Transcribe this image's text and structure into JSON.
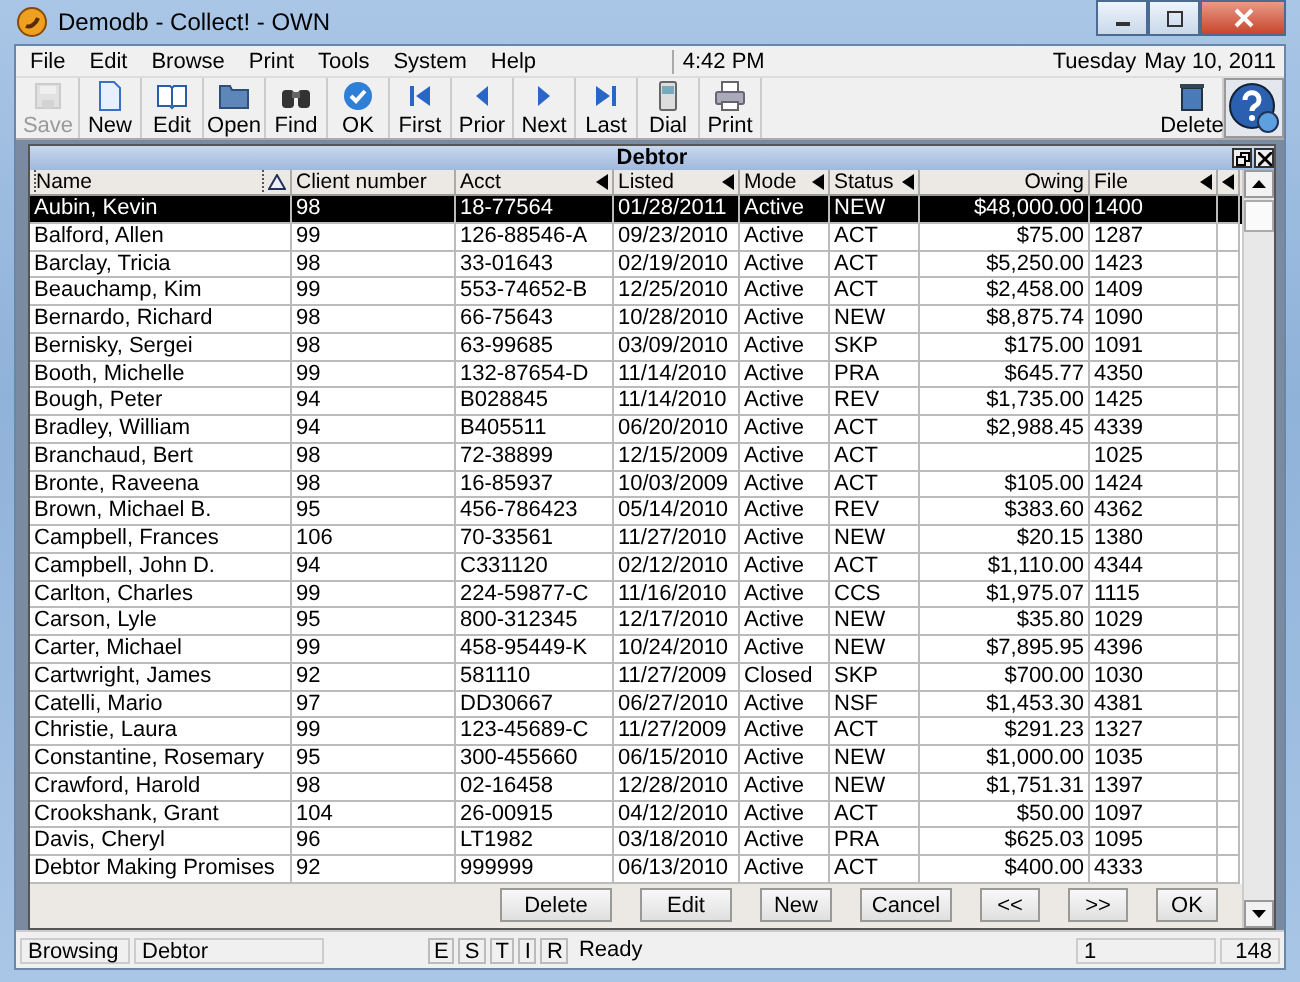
{
  "window": {
    "title": "Demodb - Collect! - OWN"
  },
  "menu": [
    "File",
    "Edit",
    "Browse",
    "Print",
    "Tools",
    "System",
    "Help"
  ],
  "clock": {
    "time": "4:42 PM",
    "day": "Tuesday",
    "date": "May 10, 2011"
  },
  "toolbar": [
    {
      "label": "Save",
      "disabled": true
    },
    {
      "label": "New",
      "disabled": false
    },
    {
      "label": "Edit",
      "disabled": false
    },
    {
      "label": "Open",
      "disabled": false
    },
    {
      "label": "Find",
      "disabled": false
    },
    {
      "label": "OK",
      "disabled": false
    },
    {
      "label": "First",
      "disabled": false
    },
    {
      "label": "Prior",
      "disabled": false
    },
    {
      "label": "Next",
      "disabled": false
    },
    {
      "label": "Last",
      "disabled": false
    },
    {
      "label": "Dial",
      "disabled": false
    },
    {
      "label": "Print",
      "disabled": false
    }
  ],
  "toolbar_right": {
    "label": "Delete"
  },
  "subwindow": {
    "title": "Debtor"
  },
  "table": {
    "columns": [
      {
        "label": "Name",
        "sorted": true,
        "filter": false
      },
      {
        "label": "Client number",
        "sorted": false,
        "filter": false
      },
      {
        "label": "Acct",
        "sorted": false,
        "filter": true
      },
      {
        "label": "Listed",
        "sorted": false,
        "filter": true
      },
      {
        "label": "Mode",
        "sorted": false,
        "filter": true
      },
      {
        "label": "Status",
        "sorted": false,
        "filter": true
      },
      {
        "label": "Owing",
        "sorted": false,
        "filter": false
      },
      {
        "label": "File",
        "sorted": false,
        "filter": true
      }
    ],
    "rows": [
      {
        "name": "Aubin, Kevin",
        "client": "98",
        "acct": "18-77564",
        "listed": "01/28/2011",
        "mode": "Active",
        "status": "NEW",
        "owing": "$48,000.00",
        "file": "1400",
        "selected": true
      },
      {
        "name": "Balford, Allen",
        "client": "99",
        "acct": "126-88546-A",
        "listed": "09/23/2010",
        "mode": "Active",
        "status": "ACT",
        "owing": "$75.00",
        "file": "1287",
        "selected": false
      },
      {
        "name": "Barclay, Tricia",
        "client": "98",
        "acct": "33-01643",
        "listed": "02/19/2010",
        "mode": "Active",
        "status": "ACT",
        "owing": "$5,250.00",
        "file": "1423",
        "selected": false
      },
      {
        "name": "Beauchamp, Kim",
        "client": "99",
        "acct": "553-74652-B",
        "listed": "12/25/2010",
        "mode": "Active",
        "status": "ACT",
        "owing": "$2,458.00",
        "file": "1409",
        "selected": false
      },
      {
        "name": "Bernardo, Richard",
        "client": "98",
        "acct": "66-75643",
        "listed": "10/28/2010",
        "mode": "Active",
        "status": "NEW",
        "owing": "$8,875.74",
        "file": "1090",
        "selected": false
      },
      {
        "name": "Bernisky, Sergei",
        "client": "98",
        "acct": "63-99685",
        "listed": "03/09/2010",
        "mode": "Active",
        "status": "SKP",
        "owing": "$175.00",
        "file": "1091",
        "selected": false
      },
      {
        "name": "Booth, Michelle",
        "client": "99",
        "acct": "132-87654-D",
        "listed": "11/14/2010",
        "mode": "Active",
        "status": "PRA",
        "owing": "$645.77",
        "file": "4350",
        "selected": false
      },
      {
        "name": "Bough, Peter",
        "client": "94",
        "acct": "B028845",
        "listed": "11/14/2010",
        "mode": "Active",
        "status": "REV",
        "owing": "$1,735.00",
        "file": "1425",
        "selected": false
      },
      {
        "name": "Bradley, William",
        "client": "94",
        "acct": "B405511",
        "listed": "06/20/2010",
        "mode": "Active",
        "status": "ACT",
        "owing": "$2,988.45",
        "file": "4339",
        "selected": false
      },
      {
        "name": "Branchaud, Bert",
        "client": "98",
        "acct": "72-38899",
        "listed": "12/15/2009",
        "mode": "Active",
        "status": "ACT",
        "file": "1025",
        "selected": false
      },
      {
        "name": "Bronte, Raveena",
        "client": "98",
        "acct": "16-85937",
        "listed": "10/03/2009",
        "mode": "Active",
        "status": "ACT",
        "owing": "$105.00",
        "file": "1424",
        "selected": false
      },
      {
        "name": "Brown, Michael B.",
        "client": "95",
        "acct": "456-786423",
        "listed": "05/14/2010",
        "mode": "Active",
        "status": "REV",
        "owing": "$383.60",
        "file": "4362",
        "selected": false
      },
      {
        "name": "Campbell, Frances",
        "client": "106",
        "acct": "70-33561",
        "listed": "11/27/2010",
        "mode": "Active",
        "status": "NEW",
        "owing": "$20.15",
        "file": "1380",
        "selected": false
      },
      {
        "name": "Campbell, John D.",
        "client": "94",
        "acct": "C331120",
        "listed": "02/12/2010",
        "mode": "Active",
        "status": "ACT",
        "owing": "$1,110.00",
        "file": "4344",
        "selected": false
      },
      {
        "name": "Carlton, Charles",
        "client": "99",
        "acct": "224-59877-C",
        "listed": "11/16/2010",
        "mode": "Active",
        "status": "CCS",
        "owing": "$1,975.07",
        "file": "1115",
        "selected": false
      },
      {
        "name": "Carson, Lyle",
        "client": "95",
        "acct": "800-312345",
        "listed": "12/17/2010",
        "mode": "Active",
        "status": "NEW",
        "owing": "$35.80",
        "file": "1029",
        "selected": false
      },
      {
        "name": "Carter, Michael",
        "client": "99",
        "acct": "458-95449-K",
        "listed": "10/24/2010",
        "mode": "Active",
        "status": "NEW",
        "owing": "$7,895.95",
        "file": "4396",
        "selected": false
      },
      {
        "name": "Cartwright, James",
        "client": "92",
        "acct": "581110",
        "listed": "11/27/2009",
        "mode": "Closed",
        "status": "SKP",
        "owing": "$700.00",
        "file": "1030",
        "selected": false
      },
      {
        "name": "Catelli, Mario",
        "client": "97",
        "acct": "DD30667",
        "listed": "06/27/2010",
        "mode": "Active",
        "status": "NSF",
        "owing": "$1,453.30",
        "file": "4381",
        "selected": false
      },
      {
        "name": "Christie, Laura",
        "client": "99",
        "acct": "123-45689-C",
        "listed": "11/27/2009",
        "mode": "Active",
        "status": "ACT",
        "owing": "$291.23",
        "file": "1327",
        "selected": false
      },
      {
        "name": "Constantine, Rosemary",
        "client": "95",
        "acct": "300-455660",
        "listed": "06/15/2010",
        "mode": "Active",
        "status": "NEW",
        "owing": "$1,000.00",
        "file": "1035",
        "selected": false
      },
      {
        "name": "Crawford, Harold",
        "client": "98",
        "acct": "02-16458",
        "listed": "12/28/2010",
        "mode": "Active",
        "status": "NEW",
        "owing": "$1,751.31",
        "file": "1397",
        "selected": false
      },
      {
        "name": "Crookshank, Grant",
        "client": "104",
        "acct": "26-00915",
        "listed": "04/12/2010",
        "mode": "Active",
        "status": "ACT",
        "owing": "$50.00",
        "file": "1097",
        "selected": false
      },
      {
        "name": "Davis, Cheryl",
        "client": "96",
        "acct": "LT1982",
        "listed": "03/18/2010",
        "mode": "Active",
        "status": "PRA",
        "owing": "$625.03",
        "file": "1095",
        "selected": false
      },
      {
        "name": "Debtor Making Promises",
        "client": "92",
        "acct": "999999",
        "listed": "06/13/2010",
        "mode": "Active",
        "status": "ACT",
        "owing": "$400.00",
        "file": "4333",
        "selected": false
      }
    ]
  },
  "buttons": [
    "Delete",
    "Edit",
    "New",
    "Cancel",
    "<<",
    ">>",
    "OK"
  ],
  "status_bar": {
    "mode": "Browsing",
    "table": "Debtor",
    "flags": [
      "E",
      "S",
      "T",
      "I",
      "R"
    ],
    "message": "Ready",
    "record": "1",
    "count": "148"
  }
}
